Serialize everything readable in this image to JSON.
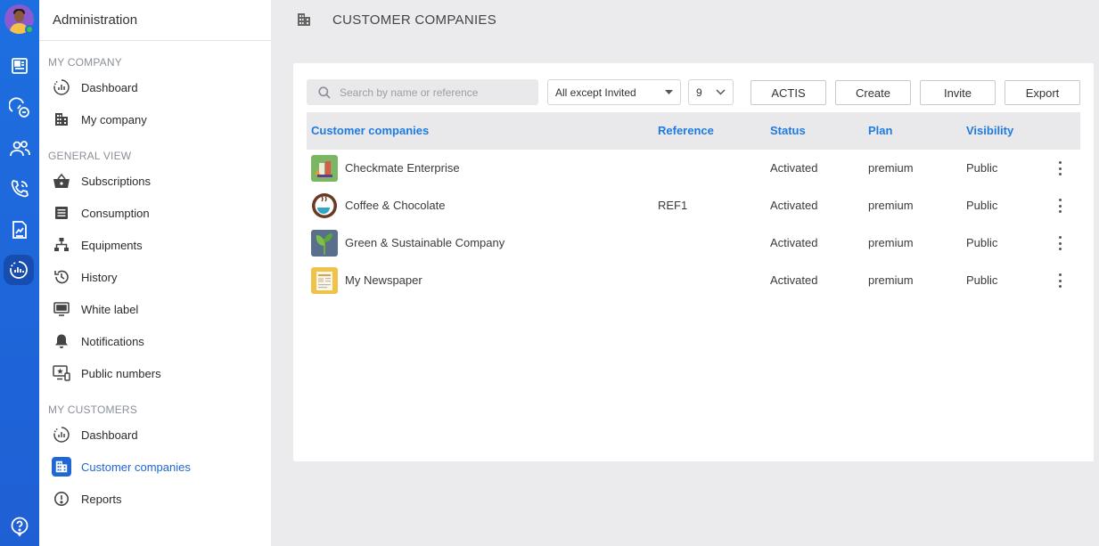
{
  "app": {
    "section_title": "Administration",
    "page_title": "CUSTOMER COMPANIES"
  },
  "rail": {
    "icons": [
      "newspaper-icon",
      "gauge-phone-icon",
      "users-icon",
      "phone-icon",
      "document-icon",
      "analytics-icon",
      "help-icon"
    ],
    "active": "analytics-icon"
  },
  "sidebar": {
    "sections": [
      {
        "label": "MY COMPANY",
        "items": [
          {
            "label": "Dashboard",
            "icon": "dashboard-icon"
          },
          {
            "label": "My company",
            "icon": "building-icon"
          }
        ]
      },
      {
        "label": "GENERAL VIEW",
        "items": [
          {
            "label": "Subscriptions",
            "icon": "basket-icon"
          },
          {
            "label": "Consumption",
            "icon": "list-icon"
          },
          {
            "label": "Equipments",
            "icon": "hierarchy-icon"
          },
          {
            "label": "History",
            "icon": "history-icon"
          },
          {
            "label": "White label",
            "icon": "monitor-icon"
          },
          {
            "label": "Notifications",
            "icon": "bell-icon"
          },
          {
            "label": "Public numbers",
            "icon": "star-screen-icon"
          }
        ]
      },
      {
        "label": "MY CUSTOMERS",
        "items": [
          {
            "label": "Dashboard",
            "icon": "dashboard-icon"
          },
          {
            "label": "Customer companies",
            "icon": "building-icon",
            "active": true
          },
          {
            "label": "Reports",
            "icon": "alert-icon"
          }
        ]
      }
    ]
  },
  "toolbar": {
    "search_placeholder": "Search by name or reference",
    "filter_value": "All except Invited",
    "page_size_value": "9",
    "actis_label": "ACTIS",
    "create_label": "Create",
    "invite_label": "Invite",
    "export_label": "Export"
  },
  "table": {
    "headers": {
      "name": "Customer companies",
      "reference": "Reference",
      "status": "Status",
      "plan": "Plan",
      "visibility": "Visibility"
    },
    "rows": [
      {
        "name": "Checkmate Enterprise",
        "reference": "",
        "status": "Activated",
        "plan": "premium",
        "visibility": "Public",
        "logo": "chess-logo"
      },
      {
        "name": "Coffee & Chocolate",
        "reference": "REF1",
        "status": "Activated",
        "plan": "premium",
        "visibility": "Public",
        "logo": "coffee-logo"
      },
      {
        "name": "Green & Sustainable Company",
        "reference": "",
        "status": "Activated",
        "plan": "premium",
        "visibility": "Public",
        "logo": "leaf-logo"
      },
      {
        "name": "My Newspaper",
        "reference": "",
        "status": "Activated",
        "plan": "premium",
        "visibility": "Public",
        "logo": "newspaper-logo"
      }
    ]
  },
  "colors": {
    "rail": "#1d6fe0",
    "accent": "#1e7be0",
    "header_bg": "#e9e9ec",
    "page_bg": "#ebebed"
  }
}
